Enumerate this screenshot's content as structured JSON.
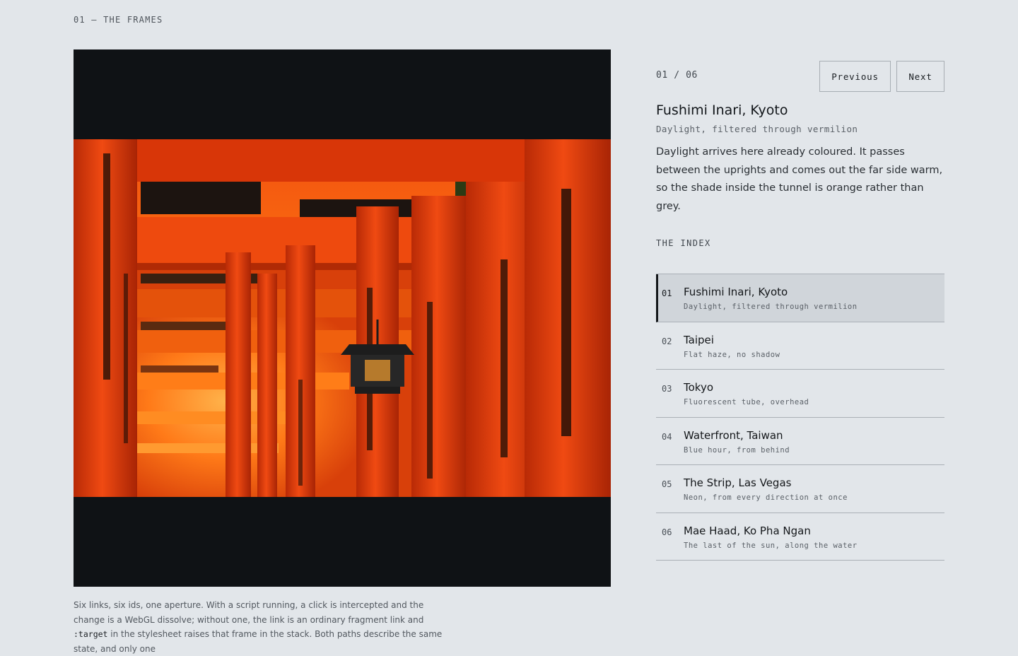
{
  "section": {
    "label": "01 — THE FRAMES"
  },
  "viewer": {
    "image_alt": "Fushimi Inari, Kyoto",
    "caption_part1": "Six links, six ids, one aperture. With a script running, a click is intercepted and the change is a WebGL dissolve; without one, the link is an ordinary fragment link and ",
    "caption_code": ":target",
    "caption_part2": " in the stylesheet raises that frame in the stack. Both paths describe the same state, and only one"
  },
  "panel": {
    "counter": "01 / 06",
    "previous_label": "Previous",
    "next_label": "Next",
    "title": "Fushimi Inari, Kyoto",
    "subtitle": "Daylight, filtered through vermilion",
    "body": "Daylight arrives here already coloured. It passes between the uprights and comes out the far side warm, so the shade inside the tunnel is orange rather than grey."
  },
  "index": {
    "label": "THE INDEX",
    "items": [
      {
        "num": "01",
        "name": "Fushimi Inari, Kyoto",
        "note": "Daylight, filtered through vermilion"
      },
      {
        "num": "02",
        "name": "Taipei",
        "note": "Flat haze, no shadow"
      },
      {
        "num": "03",
        "name": "Tokyo",
        "note": "Fluorescent tube, overhead"
      },
      {
        "num": "04",
        "name": "Waterfront, Taiwan",
        "note": "Blue hour, from behind"
      },
      {
        "num": "05",
        "name": "The Strip, Las Vegas",
        "note": "Neon, from every direction at once"
      },
      {
        "num": "06",
        "name": "Mae Haad, Ko Pha Ngan",
        "note": "The last of the sun, along the water"
      }
    ]
  },
  "colors": {
    "background": "#e2e6ea",
    "frame_matte": "#0f1215",
    "active_row": "#d0d5da",
    "vermilion": "#e8420f"
  }
}
